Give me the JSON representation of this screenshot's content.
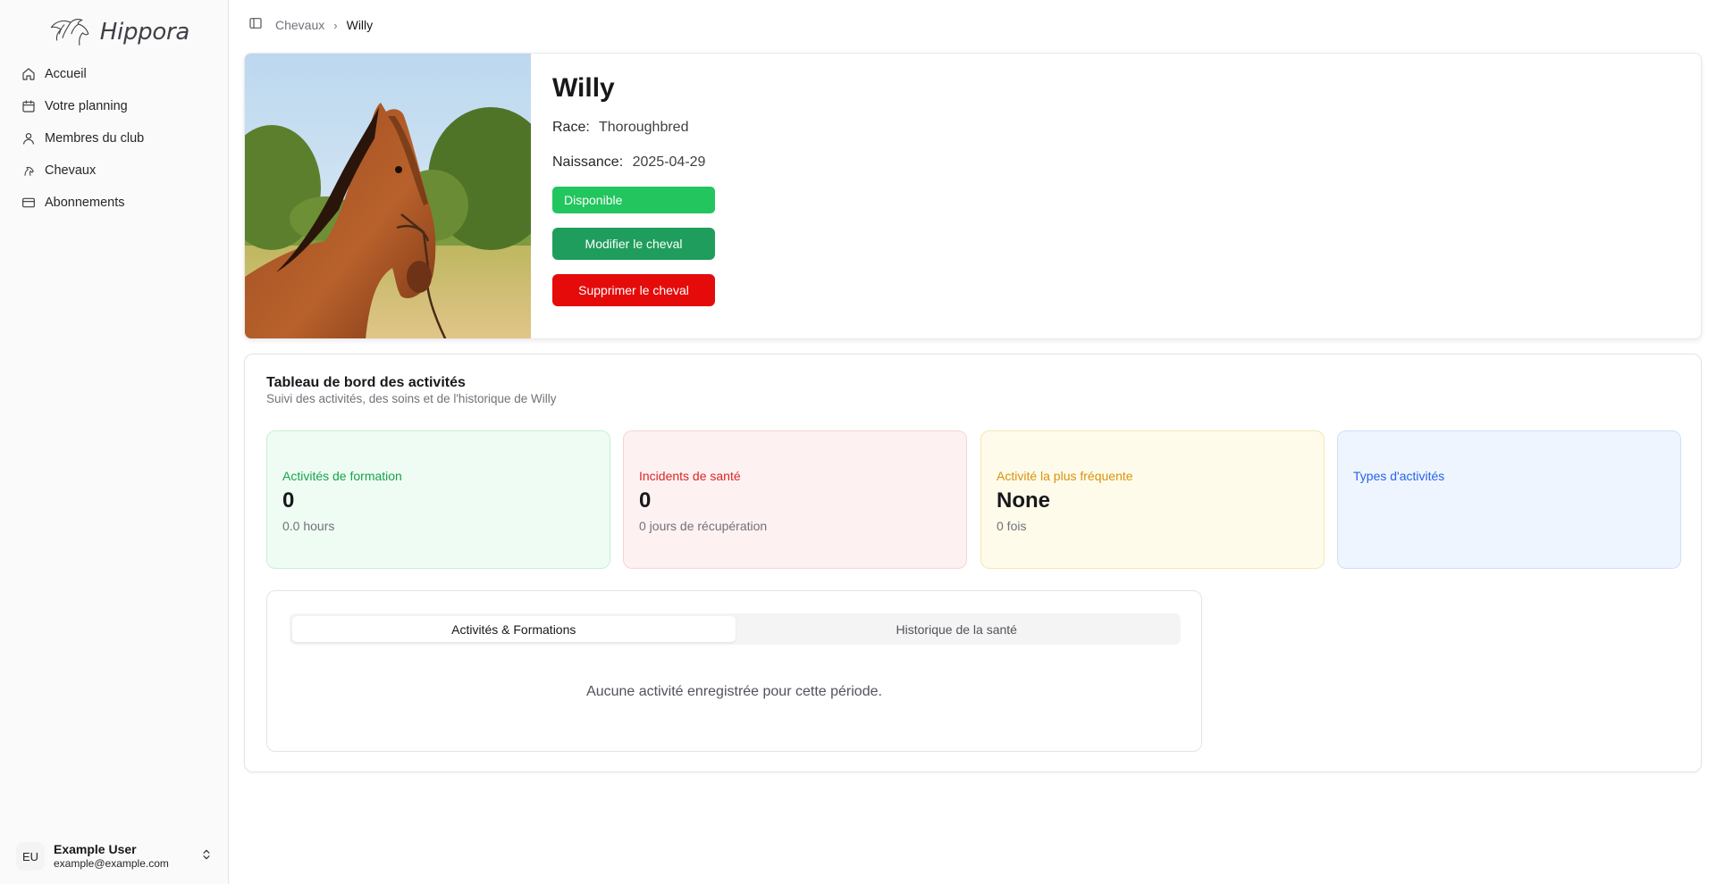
{
  "app": {
    "name": "Hippora"
  },
  "sidebar": {
    "items": [
      {
        "label": "Accueil",
        "icon": "home-icon"
      },
      {
        "label": "Votre planning",
        "icon": "calendar-icon"
      },
      {
        "label": "Membres du club",
        "icon": "user-icon"
      },
      {
        "label": "Chevaux",
        "icon": "horse-icon"
      },
      {
        "label": "Abonnements",
        "icon": "credit-card-icon"
      }
    ],
    "user": {
      "initials": "EU",
      "name": "Example User",
      "email": "example@example.com"
    }
  },
  "breadcrumb": {
    "parent": "Chevaux",
    "separator": "›",
    "current": "Willy"
  },
  "horse": {
    "name": "Willy",
    "race_label": "Race:",
    "race": "Thoroughbred",
    "birth_label": "Naissance:",
    "birth": "2025-04-29",
    "status": "Disponible",
    "status_color": "#22c55e",
    "edit_label": "Modifier le cheval",
    "delete_label": "Supprimer le cheval"
  },
  "dashboard": {
    "title": "Tableau de bord des activités",
    "subtitle": "Suivi des activités, des soins et de l'historique de Willy",
    "stats": [
      {
        "label": "Activités de formation",
        "value": "0",
        "note": "0.0 hours",
        "color": "#16a34a"
      },
      {
        "label": "Incidents de santé",
        "value": "0",
        "note": "0 jours de récupération",
        "color": "#dc2626"
      },
      {
        "label": "Activité la plus fréquente",
        "value": "None",
        "note": "0 fois",
        "color": "#d9930d"
      },
      {
        "label": "Types d'activités",
        "color": "#2563eb"
      }
    ],
    "tabs": [
      {
        "label": "Activités & Formations",
        "active": true
      },
      {
        "label": "Historique de la santé",
        "active": false
      }
    ],
    "empty_text": "Aucune activité enregistrée pour cette période."
  }
}
